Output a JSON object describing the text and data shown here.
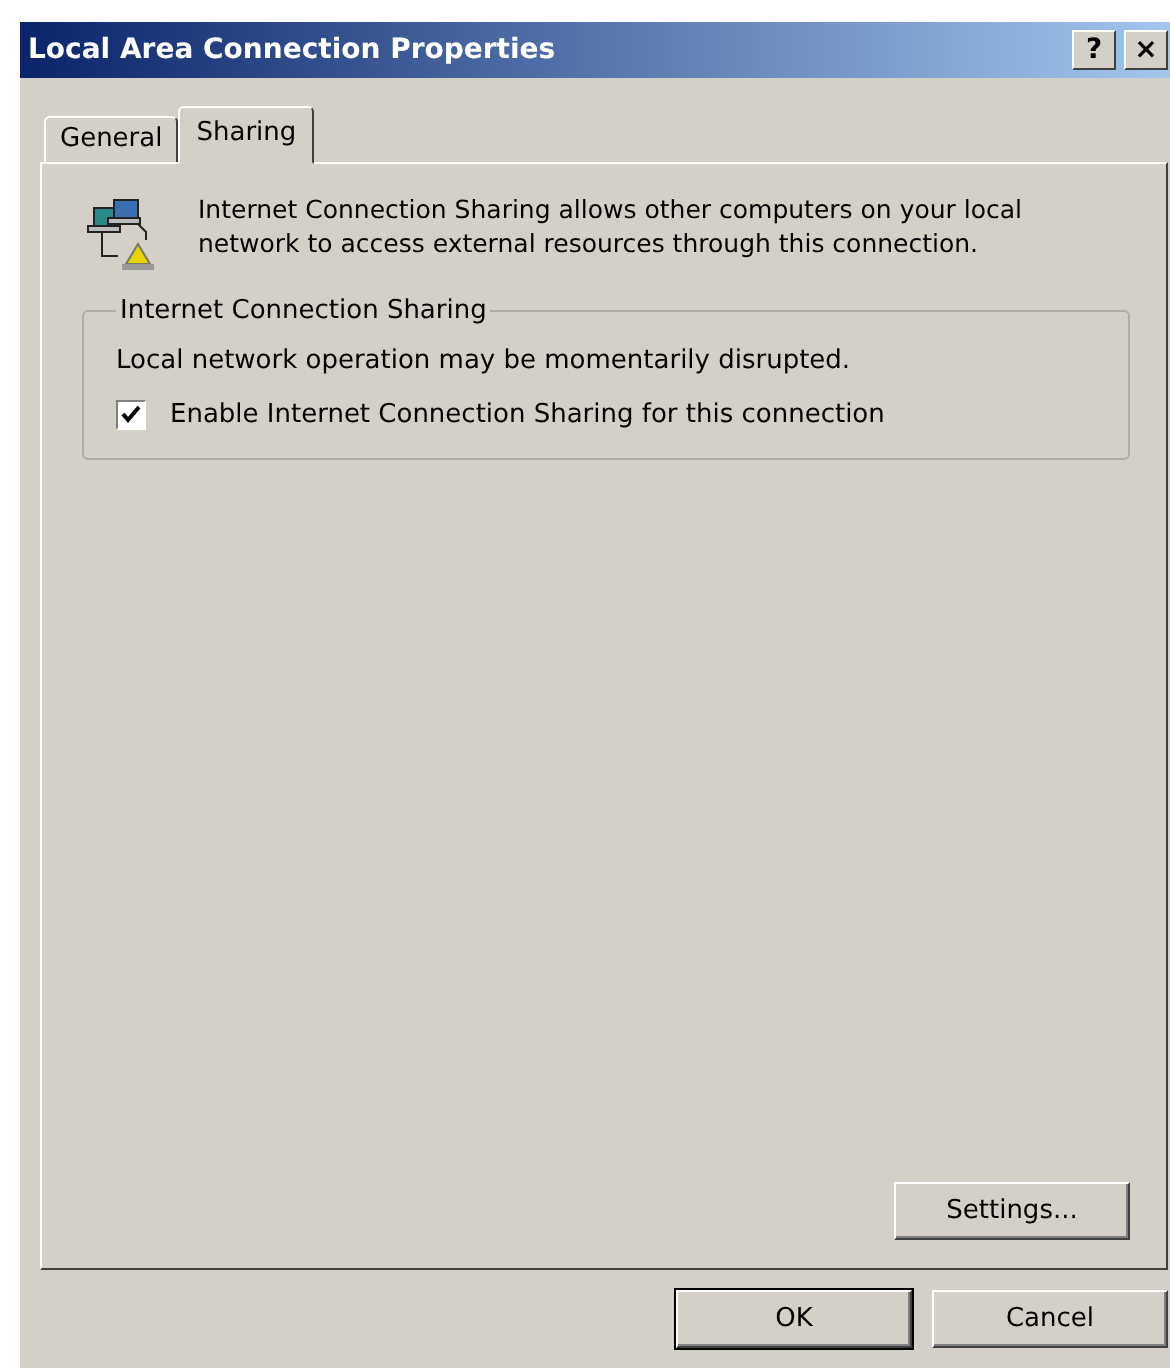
{
  "window": {
    "title": "Local Area Connection Properties"
  },
  "title_buttons": [
    {
      "kind": "help",
      "label": "?"
    },
    {
      "kind": "close",
      "label": "×"
    }
  ],
  "tabs": [
    {
      "label": "General",
      "selected": false
    },
    {
      "label": "Sharing",
      "selected": true
    }
  ],
  "intro": "Internet Connection Sharing allows other computers on your local network to access external resources through this connection.",
  "group": {
    "title": "Internet Connection Sharing",
    "note": "Local network operation may be momentarily disrupted.",
    "checkbox": {
      "label": "Enable Internet Connection Sharing for this connection",
      "checked": true
    }
  },
  "settings_button": "Settings...",
  "buttons": [
    {
      "label": "OK",
      "default": true
    },
    {
      "label": "Cancel",
      "default": false
    }
  ]
}
